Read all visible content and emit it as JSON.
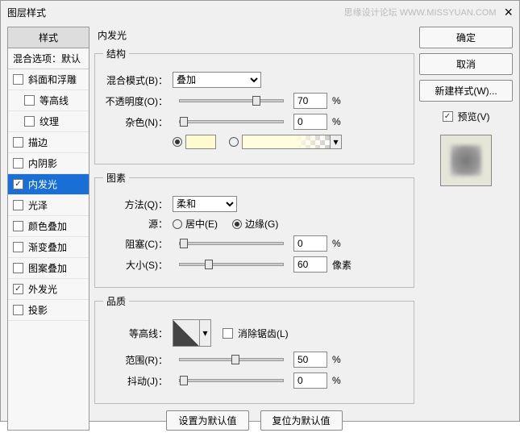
{
  "titlebar": {
    "title": "图层样式",
    "watermark": "思缘设计论坛   WWW.MISSYUAN.COM"
  },
  "left": {
    "header": "样式",
    "sub": "混合选项：默认",
    "items": [
      {
        "label": "斜面和浮雕",
        "checked": false,
        "indent": false
      },
      {
        "label": "等高线",
        "checked": false,
        "indent": true
      },
      {
        "label": "纹理",
        "checked": false,
        "indent": true
      },
      {
        "label": "描边",
        "checked": false,
        "indent": false
      },
      {
        "label": "内阴影",
        "checked": false,
        "indent": false
      },
      {
        "label": "内发光",
        "checked": true,
        "indent": false,
        "selected": true
      },
      {
        "label": "光泽",
        "checked": false,
        "indent": false
      },
      {
        "label": "颜色叠加",
        "checked": false,
        "indent": false
      },
      {
        "label": "渐变叠加",
        "checked": false,
        "indent": false
      },
      {
        "label": "图案叠加",
        "checked": false,
        "indent": false
      },
      {
        "label": "外发光",
        "checked": true,
        "indent": false
      },
      {
        "label": "投影",
        "checked": false,
        "indent": false
      }
    ]
  },
  "center": {
    "title": "内发光",
    "structure": {
      "legend": "结构",
      "blend_label": "混合模式(B)：",
      "blend_value": "叠加",
      "opacity_label": "不透明度(O)：",
      "opacity_value": "70",
      "opacity_unit": "%",
      "noise_label": "杂色(N)：",
      "noise_value": "0",
      "noise_unit": "%",
      "color_swatch": "#fefbd0"
    },
    "elements": {
      "legend": "图素",
      "method_label": "方法(Q)：",
      "method_value": "柔和",
      "source_label": "源：",
      "source_center": "居中(E)",
      "source_edge": "边缘(G)",
      "choke_label": "阻塞(C)：",
      "choke_value": "0",
      "choke_unit": "%",
      "size_label": "大小(S)：",
      "size_value": "60",
      "size_unit": "像素"
    },
    "quality": {
      "legend": "品质",
      "contour_label": "等高线：",
      "antialias_label": "消除锯齿(L)",
      "range_label": "范围(R)：",
      "range_value": "50",
      "range_unit": "%",
      "jitter_label": "抖动(J)：",
      "jitter_value": "0",
      "jitter_unit": "%"
    },
    "buttons": {
      "default": "设置为默认值",
      "reset": "复位为默认值"
    }
  },
  "right": {
    "ok": "确定",
    "cancel": "取消",
    "newstyle": "新建样式(W)...",
    "preview_label": "预览(V)"
  }
}
